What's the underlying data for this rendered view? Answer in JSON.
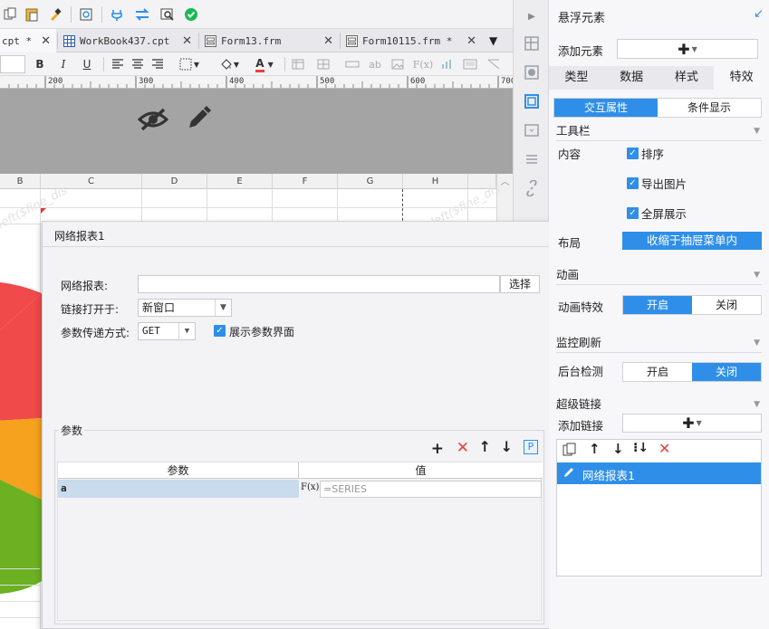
{
  "toolbar": {
    "icons": [
      "copy-icon",
      "paste-icon",
      "format-painter-icon",
      "preview-icon",
      "plug-icon",
      "swap-icon",
      "inspect-icon",
      "check-icon"
    ]
  },
  "tabs": [
    {
      "label": "cpt *"
    },
    {
      "label": "WorkBook437.cpt"
    },
    {
      "label": "Form13.frm"
    },
    {
      "label": "Form10115.frm *"
    }
  ],
  "format_toolbar": {
    "bold": "B",
    "italic": "I",
    "underline": "U",
    "fx": "F(x)",
    "text_sample": "ab",
    "font_color": "A"
  },
  "ruler": {
    "labels": [
      "200",
      "300",
      "400",
      "500",
      "600",
      "700"
    ]
  },
  "sheet": {
    "columns": [
      "B",
      "C",
      "D",
      "E",
      "F",
      "G",
      "H"
    ],
    "watermark": "left($fine_dis"
  },
  "dialog": {
    "title": "网络报表1",
    "report_label": "网络报表:",
    "select_button": "选择",
    "open_in_label": "链接打开于:",
    "open_in_value": "新窗口",
    "method_label": "参数传递方式:",
    "method_value": "GET",
    "show_params_label": "展示参数界面",
    "params_section": "参数",
    "param_col_header": "参数",
    "value_col_header": "值",
    "param_name": "a",
    "param_value": "=SERIES",
    "fx_label": "F(x)"
  },
  "right_panel": {
    "title": "悬浮元素",
    "add_element_label": "添加元素",
    "tabs": [
      "类型",
      "数据",
      "样式",
      "特效"
    ],
    "active_tab": "特效",
    "subtabs": [
      "交互属性",
      "条件显示"
    ],
    "active_subtab": "交互属性",
    "toolbar_section": "工具栏",
    "content_label": "内容",
    "checkboxes": [
      "排序",
      "导出图片",
      "全屏展示"
    ],
    "layout_label": "布局",
    "layout_value": "收缩于抽屉菜单内",
    "animation_section": "动画",
    "animation_effect_label": "动画特效",
    "on_label": "开启",
    "off_label": "关闭",
    "monitor_section": "监控刷新",
    "background_check_label": "后台检测",
    "hyperlink_section": "超级链接",
    "add_link_label": "添加链接",
    "link_item": "网络报表1"
  },
  "colors": {
    "accent": "#2f8fe8",
    "danger": "#e8413b",
    "chart_red": "#f04a4a",
    "chart_orange": "#f6a21e",
    "chart_green": "#6cb122",
    "chart_teal": "#1bb3b7"
  }
}
